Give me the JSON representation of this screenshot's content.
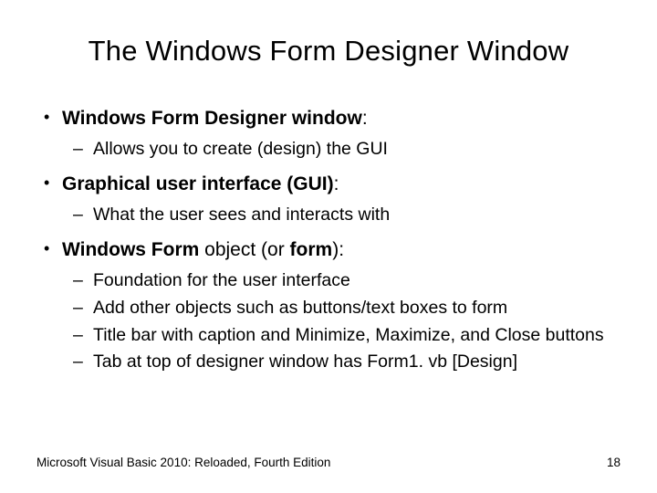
{
  "title": "The Windows Form Designer Window",
  "bullets": {
    "b0": {
      "head_bold": "Windows Form Designer window",
      "head_tail": ":",
      "s0": "Allows you to create (design) the GUI"
    },
    "b1": {
      "head_bold": "Graphical user interface (GUI)",
      "head_tail": ":",
      "s0": "What the user sees and interacts with"
    },
    "b2": {
      "head_bold": "Windows Form",
      "head_plain": " object (or ",
      "head_bold2": "form",
      "head_tail": "):",
      "s0": "Foundation for the user interface",
      "s1": "Add other objects such as buttons/text boxes to form",
      "s2": "Title bar with caption and Minimize, Maximize, and Close buttons",
      "s3": "Tab at top of designer window has Form1. vb [Design]"
    }
  },
  "footer": {
    "left": "Microsoft Visual Basic 2010: Reloaded, Fourth Edition",
    "right": "18"
  }
}
